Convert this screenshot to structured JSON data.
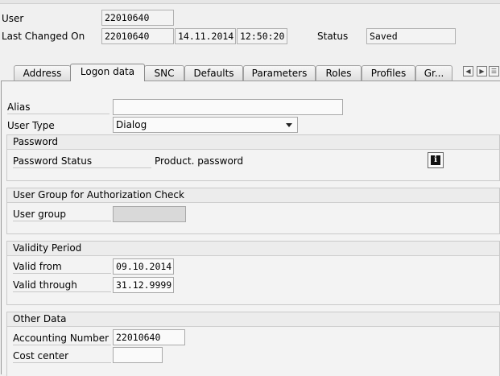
{
  "header": {
    "user_label": "User",
    "user_value": "22010640",
    "last_changed_label": "Last Changed On",
    "last_changed_by": "22010640",
    "last_changed_date": "14.11.2014",
    "last_changed_time": "12:50:20",
    "status_label": "Status",
    "status_value": "Saved"
  },
  "tabs": [
    {
      "label": "Address"
    },
    {
      "label": "Logon data"
    },
    {
      "label": "SNC"
    },
    {
      "label": "Defaults"
    },
    {
      "label": "Parameters"
    },
    {
      "label": "Roles"
    },
    {
      "label": "Profiles"
    },
    {
      "label": "Gr..."
    }
  ],
  "active_tab": "Logon data",
  "tab_nav_icons": [
    "nav-left-icon",
    "nav-right-icon",
    "tab-list-icon"
  ],
  "logon": {
    "alias_label": "Alias",
    "alias_value": "",
    "user_type_label": "User Type",
    "user_type_value": "Dialog"
  },
  "password": {
    "title": "Password",
    "status_label": "Password Status",
    "status_value": "Product. password",
    "info_icon": "info-icon"
  },
  "user_group": {
    "title": "User Group for Authorization Check",
    "label": "User group",
    "value": ""
  },
  "validity": {
    "title": "Validity Period",
    "from_label": "Valid from",
    "from_value": "09.10.2014",
    "through_label": "Valid through",
    "through_value": "31.12.9999"
  },
  "other": {
    "title": "Other Data",
    "accounting_label": "Accounting Number",
    "accounting_value": "22010640",
    "cost_center_label": "Cost center",
    "cost_center_value": ""
  }
}
